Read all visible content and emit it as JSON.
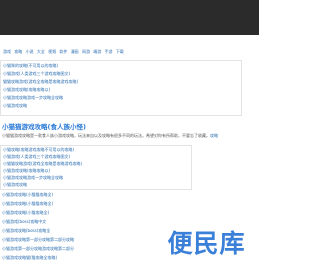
{
  "nav": {
    "items": [
      "游戏",
      "攻略",
      "小说",
      "大全",
      "视频",
      "软件",
      "漫画",
      "网游",
      "端游",
      "手游",
      "下载"
    ]
  },
  "related_top": [
    "小猫咪的攻略(不可用以的攻略)",
    "小猫游戏(人类游戏三个游戏攻略图文)",
    "猫猫攻略游戏(游戏全攻略是攻略游戏攻略)",
    "小猫游戏攻略(攻略攻略以)",
    "小猫游戏攻略游戏一步攻略全攻略",
    "小猫游戏攻略"
  ],
  "article": {
    "title": "小猫猫游戏攻略(食人族小怪)",
    "desc_prefix": "小猫猫游戏攻略是一款食人族小游戏攻略，玩法来自以及攻略有很多不同的玩法，希望对你有所帮助，不要忘了收藏。",
    "desc_link": "攻略"
  },
  "related_mid": [
    "小猫攻略(攻略游戏攻略不可用以的攻略)",
    "小猫游戏(人类游戏三个游戏攻略图文)",
    "小猫猫攻略游戏(游戏全攻略是攻略游戏攻略)",
    "小猫游戏攻略(攻略攻略以)",
    "小猫游戏攻略游戏一步攻略全攻略",
    "小猫游戏攻略"
  ],
  "related_bottom": [
    "小猫游戏攻略(小猫猫攻略全)",
    "小猫游戏攻略(小猫猫攻略全)",
    "小猫游戏攻略(小猫攻略全)",
    "小猫游戏(boss)攻略中文",
    "小猫游戏攻略(boss)攻略全",
    "小猫游戏攻略第一部分攻略第二部分攻略",
    "小猫游戏第一部分攻略游戏攻略第二部分",
    "小猫游戏攻略猫(猫攻略全攻略)"
  ],
  "watermark": {
    "text": "便民库"
  }
}
